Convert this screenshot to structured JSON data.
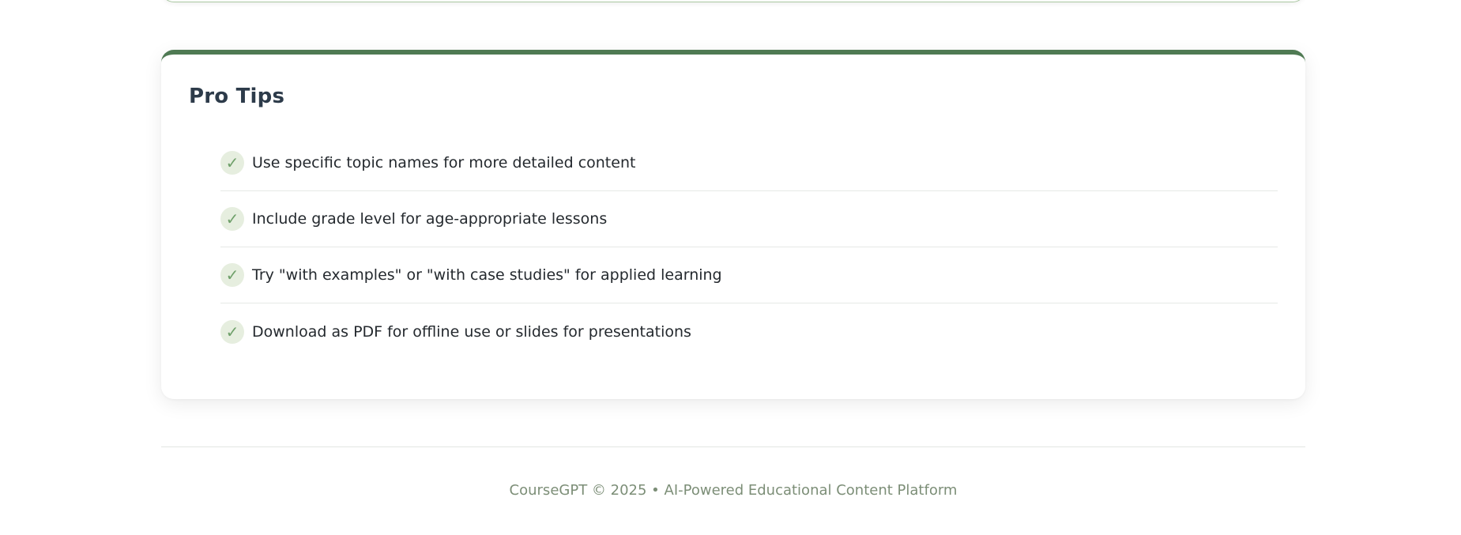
{
  "tips": {
    "title": "Pro Tips",
    "check_glyph": "✓",
    "items": [
      {
        "text": "Use specific topic names for more detailed content"
      },
      {
        "text": "Include grade level for age-appropriate lessons"
      },
      {
        "text": "Try \"with examples\" or \"with case studies\" for applied learning"
      },
      {
        "text": "Download as PDF for offline use or slides for presentations"
      }
    ]
  },
  "footer": {
    "text": "CourseGPT © 2025 • AI-Powered Educational Content Platform"
  },
  "colors": {
    "accent": "#4f7a53",
    "check_bg": "#e6eedf",
    "check_fg": "#6fa06a",
    "footer_text": "#7c8e77"
  }
}
